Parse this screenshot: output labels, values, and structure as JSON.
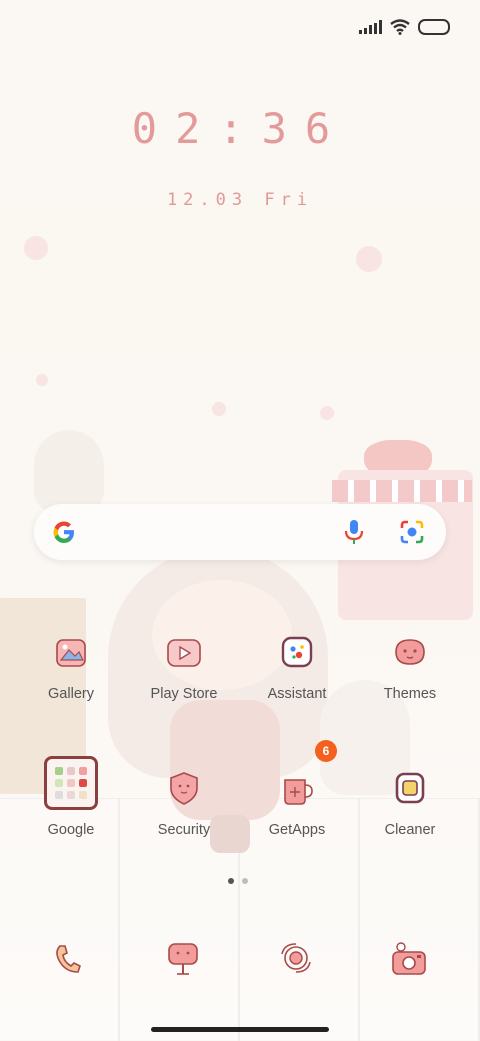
{
  "status_bar": {
    "icons": [
      "signal-icon",
      "wifi-icon",
      "battery-icon"
    ]
  },
  "clock": {
    "time": "02:36",
    "date": "12.03 Fri"
  },
  "search_bar": {
    "icons": [
      "google-g-logo",
      "microphone-icon",
      "lens-camera-icon"
    ]
  },
  "apps_row1": [
    {
      "label": "Gallery",
      "icon": "gallery-icon"
    },
    {
      "label": "Play Store",
      "icon": "play-store-icon"
    },
    {
      "label": "Assistant",
      "icon": "assistant-icon"
    },
    {
      "label": "Themes",
      "icon": "themes-icon"
    }
  ],
  "apps_row2": [
    {
      "label": "Google",
      "icon": "google-folder-icon"
    },
    {
      "label": "Security",
      "icon": "security-icon"
    },
    {
      "label": "GetApps",
      "icon": "getapps-icon",
      "badge": "6"
    },
    {
      "label": "Cleaner",
      "icon": "cleaner-icon"
    }
  ],
  "pager": {
    "pages": 2,
    "current": 1
  },
  "dock": [
    "phone-icon",
    "messages-icon",
    "browser-icon",
    "camera-icon"
  ],
  "colors": {
    "accent": "#e39a9a",
    "badge": "#f4611e",
    "icon_stroke": "#a84a4a"
  }
}
